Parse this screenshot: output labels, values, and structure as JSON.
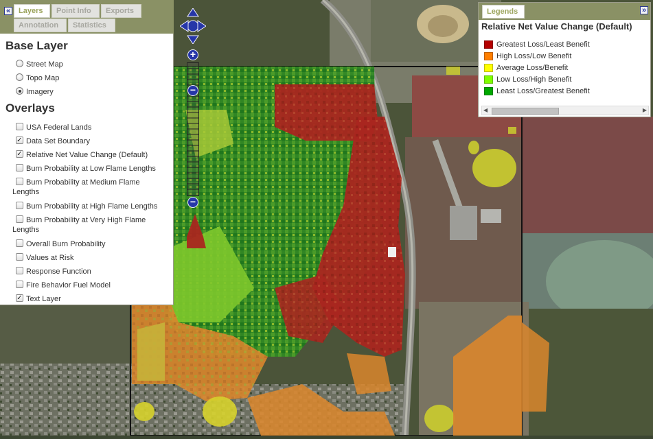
{
  "layers_panel": {
    "collapse_glyph": "«",
    "tabs": [
      {
        "label": "Layers",
        "active": true
      },
      {
        "label": "Point Info",
        "active": false
      },
      {
        "label": "Exports",
        "active": false
      },
      {
        "label": "Annotation",
        "active": false
      },
      {
        "label": "Statistics",
        "active": false
      }
    ],
    "base_layer": {
      "title": "Base Layer",
      "options": [
        {
          "label": "Street Map",
          "selected": false
        },
        {
          "label": "Topo Map",
          "selected": false
        },
        {
          "label": "Imagery",
          "selected": true
        }
      ]
    },
    "overlays": {
      "title": "Overlays",
      "items": [
        {
          "label": "USA Federal Lands",
          "checked": false
        },
        {
          "label": "Data Set Boundary",
          "checked": true
        },
        {
          "label": "Relative Net Value Change (Default)",
          "checked": true
        },
        {
          "label": "Burn Probability at Low Flame Lengths",
          "checked": false
        },
        {
          "label": "Burn Probability at Medium Flame",
          "label_cont": "Lengths",
          "checked": false
        },
        {
          "label": "Burn Probability at High Flame Lengths",
          "checked": false
        },
        {
          "label": "Burn Probability at Very High Flame",
          "label_cont": "Lengths",
          "checked": false
        },
        {
          "label": "Overall Burn Probability",
          "checked": false
        },
        {
          "label": "Values at Risk",
          "checked": false
        },
        {
          "label": "Response Function",
          "checked": false
        },
        {
          "label": "Fire Behavior Fuel Model",
          "checked": false
        },
        {
          "label": "Text Layer",
          "checked": true
        }
      ]
    }
  },
  "legend_panel": {
    "tab_label": "Legends",
    "collapse_glyph": "»",
    "title": "Relative Net Value Change (Default)",
    "items": [
      {
        "label": "Greatest Loss/Least Benefit",
        "color": "#b40000"
      },
      {
        "label": "High Loss/Low Benefit",
        "color": "#ff7f00"
      },
      {
        "label": "Average Loss/Benefit",
        "color": "#ffff00"
      },
      {
        "label": "Low Loss/High Benefit",
        "color": "#7fff00"
      },
      {
        "label": "Least Loss/Greatest Benefit",
        "color": "#00a800"
      }
    ],
    "scroll_left_glyph": "◀",
    "scroll_right_glyph": "▶"
  },
  "map_controls": {
    "pan_up": "▲",
    "pan_down": "▼",
    "pan_left": "◀",
    "pan_right": "▶",
    "zoom_in": "+",
    "zoom_out": "−"
  },
  "colors": {
    "panel_header": "#8a9165",
    "active_tab_text": "#9da55e",
    "nav_blue": "#2636a8"
  }
}
